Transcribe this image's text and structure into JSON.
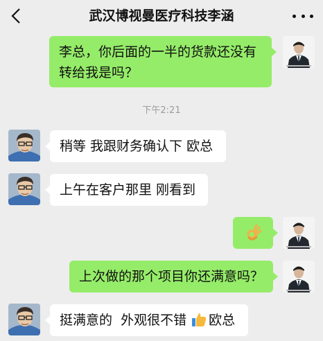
{
  "header": {
    "title": "武汉博视曼医疗科技李涵",
    "back_icon": "chevron-left-icon",
    "more_icon": "more-dots-icon"
  },
  "messages": [
    {
      "side": "me",
      "lines": [
        "李总，你后面的一半的货款还没有",
        "转给我是吗？"
      ]
    },
    {
      "side": "system",
      "text": "下午2:21"
    },
    {
      "side": "them",
      "text": "稍等 我跟财务确认下 欧总"
    },
    {
      "side": "them",
      "text": "上午在客户那里 刚看到"
    },
    {
      "side": "me",
      "emoji": "ok-hand-emoji"
    },
    {
      "side": "me",
      "text": "上次做的那个项目你还满意吗？"
    },
    {
      "side": "them",
      "text_before": "挺满意的  外观很不错",
      "emoji": "thumbs-up-emoji",
      "text_after": "欧总"
    }
  ],
  "colors": {
    "my_bubble": "#95ec69",
    "their_bubble": "#ffffff",
    "background": "#ededed"
  }
}
